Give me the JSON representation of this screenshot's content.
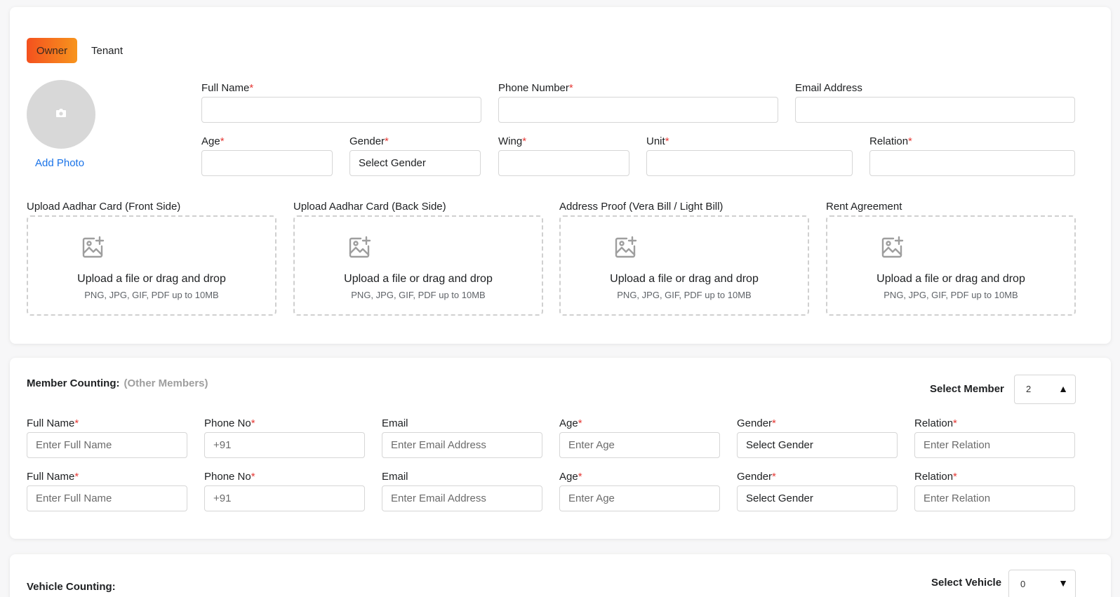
{
  "tabs": {
    "owner": "Owner",
    "tenant": "Tenant"
  },
  "photo": {
    "add_label": "Add Photo",
    "icon": "camera-icon"
  },
  "owner_form": {
    "full_name_label": "Full Name",
    "phone_label": "Phone Number",
    "email_label": "Email Address",
    "age_label": "Age",
    "gender_label": "Gender",
    "gender_value": "Select Gender",
    "wing_label": "Wing",
    "unit_label": "Unit",
    "relation_label": "Relation",
    "required_mark": "*"
  },
  "uploads": [
    {
      "label": "Upload Aadhar Card (Front Side)",
      "prompt": "Upload a file or drag and drop",
      "hint": "PNG, JPG, GIF, PDF up to 10MB"
    },
    {
      "label": "Upload Aadhar Card (Back Side)",
      "prompt": "Upload a file or drag and drop",
      "hint": "PNG, JPG, GIF, PDF up to 10MB"
    },
    {
      "label": "Address Proof (Vera Bill / Light Bill)",
      "prompt": "Upload a file or drag and drop",
      "hint": "PNG, JPG, GIF, PDF up to 10MB"
    },
    {
      "label": "Rent Agreement",
      "prompt": "Upload a file or drag and drop",
      "hint": "PNG, JPG, GIF, PDF up to 10MB"
    }
  ],
  "members": {
    "title": "Member Counting:",
    "subtitle": "(Other Members)",
    "select_label": "Select Member",
    "select_value": "2",
    "rows": [
      {
        "full_name_label": "Full Name",
        "full_name_placeholder": "Enter Full Name",
        "phone_label": "Phone No",
        "phone_value": "+91",
        "email_label": "Email",
        "email_placeholder": "Enter Email Address",
        "age_label": "Age",
        "age_placeholder": "Enter Age",
        "gender_label": "Gender",
        "gender_value": "Select Gender",
        "relation_label": "Relation",
        "relation_placeholder": "Enter Relation"
      },
      {
        "full_name_label": "Full Name",
        "full_name_placeholder": "Enter Full Name",
        "phone_label": "Phone No",
        "phone_value": "+91",
        "email_label": "Email",
        "email_placeholder": "Enter Email Address",
        "age_label": "Age",
        "age_placeholder": "Enter Age",
        "gender_label": "Gender",
        "gender_value": "Select Gender",
        "relation_label": "Relation",
        "relation_placeholder": "Enter Relation"
      }
    ]
  },
  "vehicles": {
    "title": "Vehicle Counting:",
    "select_label": "Select Vehicle",
    "select_value": "0"
  },
  "colors": {
    "accent_start": "#f4511e",
    "accent_end": "#f7941d",
    "link": "#1a73e8",
    "required": "#e53935"
  }
}
